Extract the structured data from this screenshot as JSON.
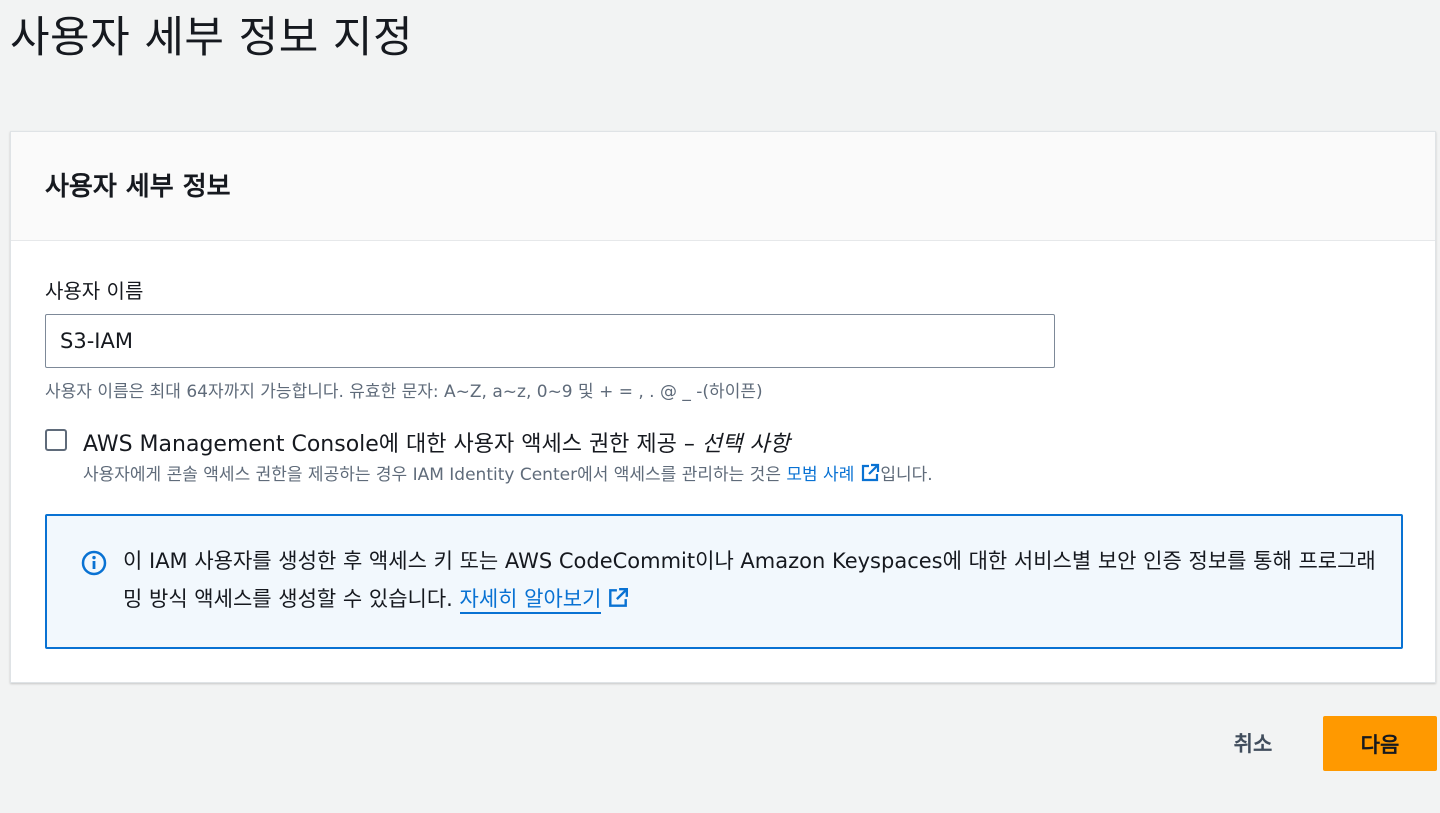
{
  "page": {
    "title": "사용자 세부 정보 지정"
  },
  "panel": {
    "title": "사용자 세부 정보",
    "username": {
      "label": "사용자 이름",
      "value": "S3-IAM",
      "hint": "사용자 이름은 최대 64자까지 가능합니다. 유효한 문자: A~Z, a~z, 0~9 및 + = , . @ _ -(하이픈)"
    },
    "console_access": {
      "checked": false,
      "label": "AWS Management Console에 대한 사용자 액세스 권한 제공 – ",
      "label_optional": "선택 사항",
      "desc_prefix": "사용자에게 콘솔 액세스 권한을 제공하는 경우 IAM Identity Center에서 액세스를 관리하는 것은 ",
      "desc_link": "모범 사례",
      "desc_suffix": "입니다."
    },
    "info": {
      "text": "이 IAM 사용자를 생성한 후 액세스 키 또는 AWS CodeCommit이나 Amazon Keyspaces에 대한 서비스별 보안 인증 정보를 통해 프로그래밍 방식 액세스를 생성할 수 있습니다. ",
      "link": "자세히 알아보기"
    }
  },
  "actions": {
    "cancel_label": "취소",
    "next_label": "다음"
  },
  "colors": {
    "link": "#0972d3",
    "primary_button": "#ff9900",
    "info_border": "#0972d3",
    "info_background": "#f2f8fd",
    "background": "#f2f3f3"
  },
  "icons": {
    "info": "info-circle-icon",
    "external": "external-link-icon"
  }
}
